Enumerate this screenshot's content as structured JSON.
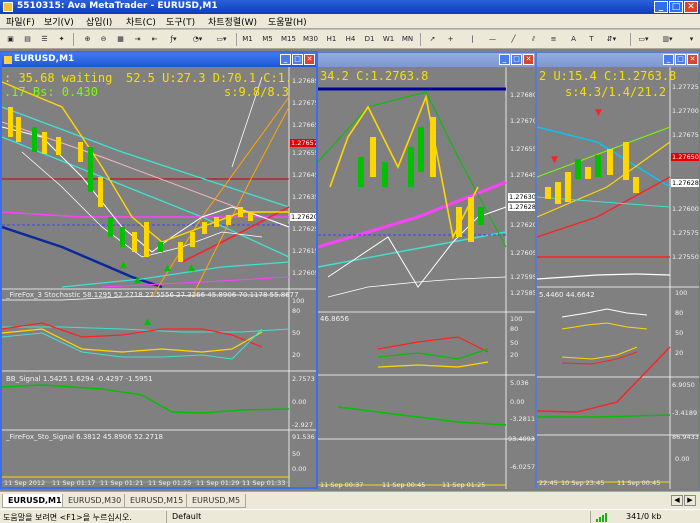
{
  "app": {
    "title": "5510315: Ava MetaTrader - EURUSD,M1"
  },
  "menu": [
    "파일(F)",
    "보기(V)",
    "삽입(I)",
    "차트(C)",
    "도구(T)",
    "차트정렬(W)",
    "도움말(H)"
  ],
  "toolbar": {
    "timeframes": [
      "M1",
      "M5",
      "M15",
      "M30",
      "H1",
      "H4",
      "D1",
      "W1",
      "MN"
    ]
  },
  "chart1": {
    "title": "EURUSD,M1",
    "overlay_line1a": ": 35.68  waiting",
    "overlay_line1b": "52.5 U:27.3 D:70.1 C:1.",
    "overlay_line2a": ".17 Bs: 0.430",
    "overlay_line2b": "s:9.8/8.3",
    "price_axis": [
      "1.27685",
      "1.27675",
      "1.27665",
      "1.27655",
      "1.27645",
      "1.27635",
      "1.27625",
      "1.27615",
      "1.27605",
      "1.27595"
    ],
    "current_price": "1.27620",
    "red_price": "1.27657",
    "stoch_label": "_FireFox_3 Stochastic 58.1295 52.2718 27.5556 27.3266 45.8906 70.1178 55.8677",
    "stoch_axis": [
      "100",
      "80",
      "50",
      "20",
      "0"
    ],
    "bb_label": "BB_Signal 1.5425 1.6294 -0.4297 -1.5951",
    "bb_axis": [
      "2.7573",
      "0.00",
      "-2.927"
    ],
    "sto_label": "_FireFox_Sto_Signal 6.3812 45.8906 52.2718",
    "sto_axis": [
      "91.536",
      "50",
      "0.00",
      "-5.115"
    ],
    "time_labels": [
      "11 Sep 2012",
      "11 Sep 01:17",
      "11 Sep 01:21",
      "11 Sep 01:25",
      "11 Sep 01:29",
      "11 Sep 01:33"
    ]
  },
  "chart2": {
    "title": "",
    "overlay_line1": "34.2 C:1.2763.8",
    "price_axis": [
      "1.27680",
      "1.27670",
      "1.27655",
      "1.27645",
      "1.27635",
      "1.27620",
      "1.27605",
      "1.27595",
      "1.27585"
    ],
    "current_price": "1.27628",
    "secondary_price": "1.27630",
    "stoch_label": "46.8656",
    "stoch_axis": [
      "100",
      "80",
      "50",
      "20",
      "0"
    ],
    "bb_axis": [
      "5.036",
      "0.00",
      "-3.2811"
    ],
    "sto_axis": [
      "93.4093",
      "50",
      "0.00",
      "-6.0257"
    ],
    "time_labels": [
      "11 Sep 00:37",
      "11 Sep 00:45",
      "11 Sep 01:25"
    ]
  },
  "chart3": {
    "title": "",
    "overlay_line1": "2 U:15.4 C:1.2763.8",
    "overlay_line2": "s:4.3/1.4/21.2",
    "price_axis": [
      "1.27725",
      "1.27700",
      "1.27675",
      "1.27650",
      "1.27625",
      "1.27600",
      "1.27575",
      "1.27550",
      "1.27525"
    ],
    "current_price": "1.27628",
    "red_price": "1.27650",
    "stoch_label": "5.4460 44.6642",
    "stoch_axis": [
      "100",
      "80",
      "50",
      "20",
      "0"
    ],
    "bb_axis": [
      "6.9050",
      "0.00",
      "-3.4189"
    ],
    "sto_axis": [
      "86.9433",
      "50",
      "0.00",
      "-6.0257"
    ],
    "time_labels": [
      "22:45",
      "10 Sep 23:45",
      "11 Sep 00:45"
    ]
  },
  "tabs": [
    "EURUSD,M1",
    "EURUSD,M30",
    "EURUSD,M15",
    "EURUSD,M5"
  ],
  "status": {
    "help": "도움말을 보려면 <F1>을 누르십시오.",
    "profile": "Default",
    "traffic": "341/0 kb"
  },
  "colors": {
    "accent": "#1f55d4",
    "chart_bg": "#808080",
    "overlay_yellow": "#f5e000",
    "overlay_green": "#7cfc00"
  }
}
